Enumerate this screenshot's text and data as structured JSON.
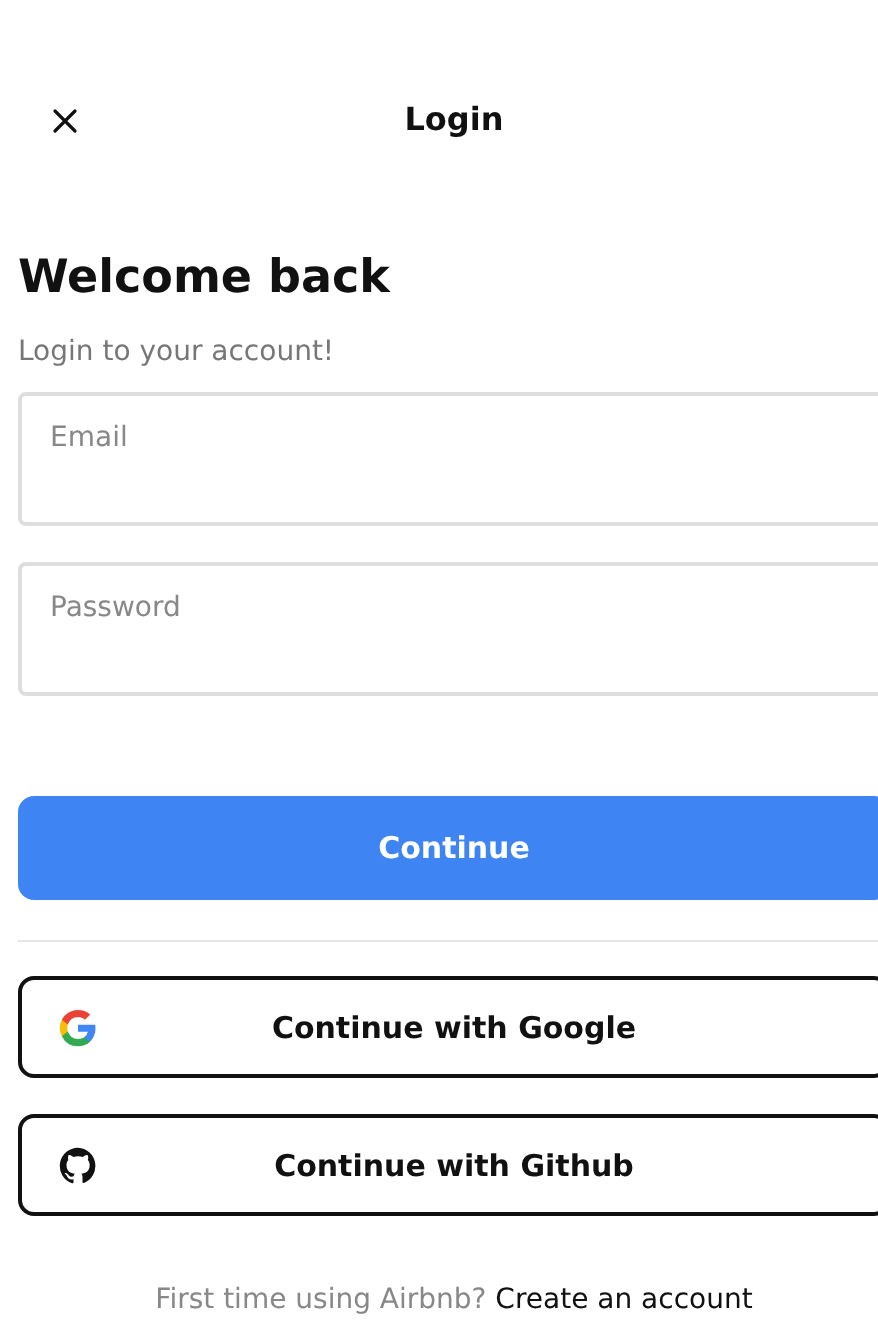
{
  "header": {
    "title": "Login"
  },
  "heading": "Welcome back",
  "subtitle": "Login to your account!",
  "fields": [
    {
      "placeholder": "Email"
    },
    {
      "placeholder": "Password"
    }
  ],
  "primary_button": "Continue",
  "social_buttons": [
    {
      "kind": "google",
      "label": "Continue with Google"
    },
    {
      "kind": "github",
      "label": "Continue with Github"
    }
  ],
  "footer": {
    "text": "First time using Airbnb?",
    "link": "Create an account"
  }
}
